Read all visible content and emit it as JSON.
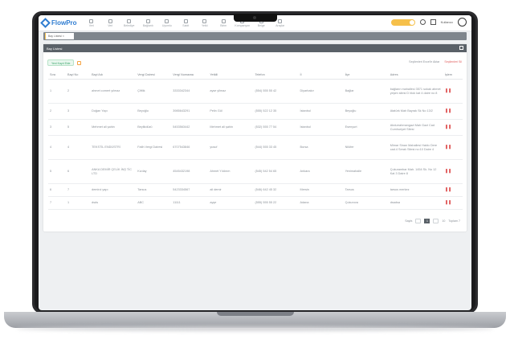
{
  "app": {
    "logo_text": "FlowPro"
  },
  "nav": [
    {
      "label": "Veri",
      "icon": "nav-icon"
    },
    {
      "label": "Veri",
      "icon": "nav-icon"
    },
    {
      "label": "Belediye",
      "icon": "nav-icon"
    },
    {
      "label": "Bağlantı",
      "icon": "nav-icon"
    },
    {
      "label": "Uyumlu",
      "icon": "nav-icon"
    },
    {
      "label": "Sabit",
      "icon": "nav-icon"
    },
    {
      "label": "Yetki",
      "icon": "nav-icon"
    },
    {
      "label": "Birim",
      "icon": "nav-icon"
    },
    {
      "label": "Kompanyon",
      "icon": "nav-icon"
    },
    {
      "label": "Belge",
      "icon": "nav-icon"
    },
    {
      "label": "Araçlar",
      "icon": "nav-icon"
    }
  ],
  "topbar": {
    "user": "Kullanıcı"
  },
  "tabs": [
    {
      "label": "Bay Listesi"
    }
  ],
  "card": {
    "title": "Bay Listesi",
    "add_label": "Yeni Kayıt Ekle",
    "link_excel": "Seçilenleri Excel'e Aktar",
    "link_delete": "Seçilenleri Sil"
  },
  "table": {
    "headers": [
      "Sıra",
      "Bayi No",
      "Bayi Adı",
      "Vergi Dairesi",
      "Vergi Numarası",
      "Yetkili",
      "Telefon",
      "İl",
      "İlçe",
      "Adres",
      "İşlem"
    ],
    "rows": [
      [
        "1",
        "2",
        "ahmet comert yılmaz",
        "Çiftlik",
        "3333342344",
        "ayse yilmaz",
        "(554) 555 55 42",
        "Diyarbakır",
        "Bağlar",
        "bağların mahallesi 3571 sokak ahmet yeşim sitesi D blok kat 4 daire no 8"
      ],
      [
        "2",
        "3",
        "Doğan Yapı",
        "Beyoğlu",
        "3985643291",
        "Pelin Gül",
        "(555) 522 12 35",
        "İstanbul",
        "Beyoğlu",
        "Atatürk Mah Bayrak Sk No 13/2"
      ],
      [
        "3",
        "5",
        "Mehmet ali şahin",
        "Beylikdüzü",
        "5453563442",
        "Mehmet ali şahin",
        "(532) 555 77 54",
        "İstanbul",
        "Esenyurt",
        "Abdurrahmangazi Mah Gazi Cad Cumhuriyet Sitesi"
      ],
      [
        "4",
        "4",
        "TEKSTİL ENDÜSTRİ",
        "Fatih Vergi Dairesi",
        "6707543846",
        "yusuf",
        "(544) 555 33 45",
        "Bursa",
        "Nilüfer",
        "Mimar Sinan Mahallesi Hakkı Dere cad.4 Seralı Sitesi no:10 Daire 4"
      ],
      [
        "5",
        "6",
        "ANKA DEMİR ÇELİK İNŞ TİC LTD",
        "Kızılay",
        "4545432198",
        "Ahmet Yıldırım",
        "(545) 542 54 65",
        "Ankara",
        "Yenimahalle",
        "Çukurambar Mah. 1454 Sk. No 12 Kat 3 Daire 8"
      ],
      [
        "6",
        "7",
        "demirci yapı",
        "Tarsus",
        "5423334567",
        "ali demir",
        "(546) 642 45 32",
        "Mersin",
        "Tarsus",
        "tarsus merkez"
      ],
      [
        "7",
        "1",
        "dsds",
        "ABC",
        "11111",
        "ayşe",
        "(555) 555 55 22",
        "Adana",
        "Çukurova",
        "dsadsa"
      ]
    ]
  },
  "pager": {
    "label": "Sayfa",
    "current": "1",
    "per_page": "10",
    "total": "Toplam 7"
  },
  "colors": {
    "accent": "#2f7dd1",
    "header_bar": "#5a6168",
    "delete": "#e05b5b",
    "toggle": "#f6c04a"
  }
}
